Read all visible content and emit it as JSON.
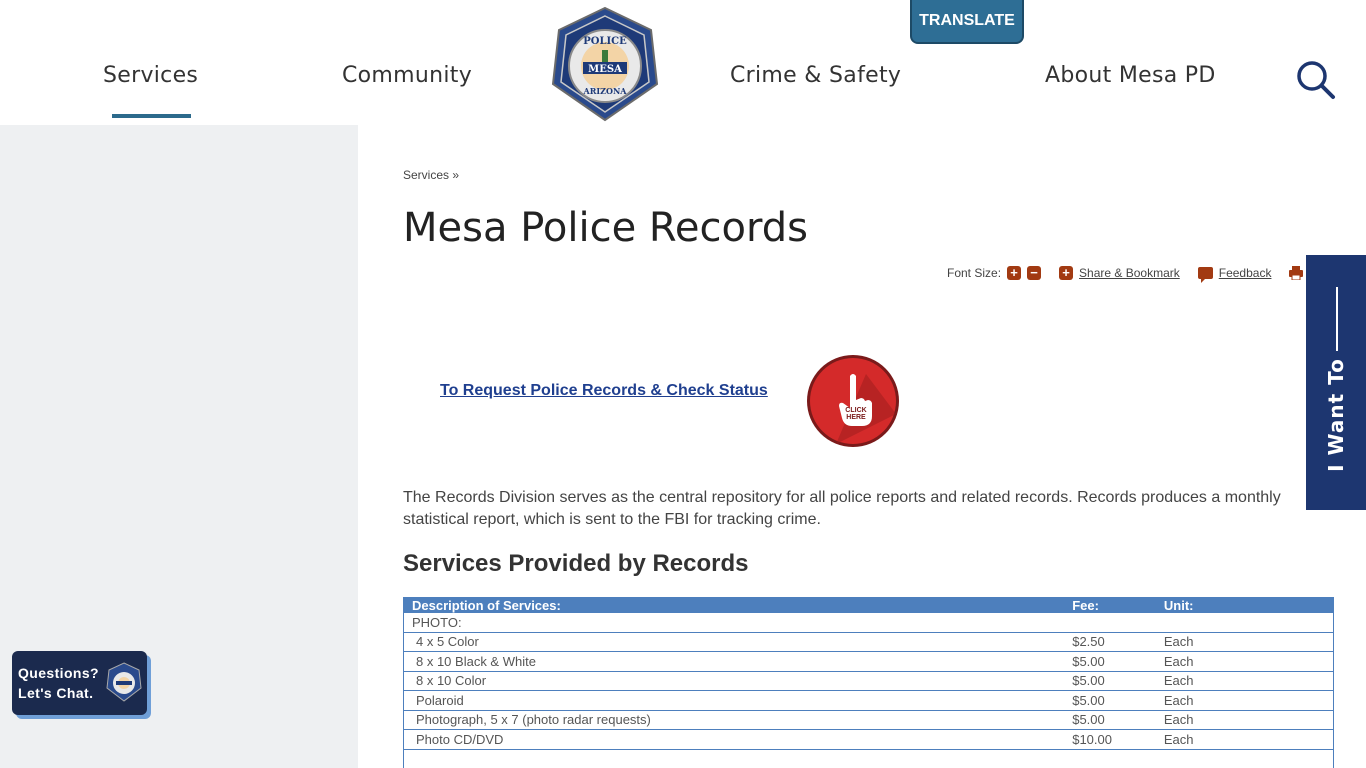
{
  "nav": {
    "items": [
      {
        "label": "Services"
      },
      {
        "label": "Community"
      },
      {
        "label": "Crime & Safety"
      },
      {
        "label": "About Mesa PD"
      }
    ],
    "translate_label": "TRANSLATE"
  },
  "logo": {
    "top_text": "POLICE",
    "middle_text": "MESA",
    "bottom_text": "ARIZONA"
  },
  "breadcrumb": {
    "label": "Services",
    "separator": "»"
  },
  "page": {
    "title": "Mesa Police Records"
  },
  "tools": {
    "font_size_label": "Font Size:",
    "share_label": "Share & Bookmark",
    "feedback_label": "Feedback"
  },
  "request": {
    "link_label": "To Request Police Records & Check Status",
    "button_text_1": "CLICK",
    "button_text_2": "HERE"
  },
  "intro_text": "The Records Division serves as the central repository for all police reports and related records. Records produces a monthly statistical report, which is sent to the FBI for tracking crime.",
  "section_title": "Services Provided by Records",
  "fees": {
    "headers": [
      "Description of Services:",
      "Fee:",
      "Unit:"
    ],
    "category": "PHOTO:",
    "rows": [
      {
        "description": "4 x 5 Color",
        "fee": "$2.50",
        "unit": "Each"
      },
      {
        "description": "8 x 10 Black & White",
        "fee": "$5.00",
        "unit": "Each"
      },
      {
        "description": "8 x 10 Color",
        "fee": "$5.00",
        "unit": "Each"
      },
      {
        "description": "Polaroid",
        "fee": "$5.00",
        "unit": "Each"
      },
      {
        "description": "Photograph, 5 x 7 (photo radar requests)",
        "fee": "$5.00",
        "unit": "Each"
      },
      {
        "description": "Photo CD/DVD",
        "fee": "$10.00",
        "unit": "Each"
      }
    ]
  },
  "i_want_to_label": "I Want To",
  "chat": {
    "line1": "Questions?",
    "line2": "Let's Chat."
  },
  "colors": {
    "accent": "#2c6a8c",
    "table_header": "#4d7fbd",
    "tool_icon": "#a23a12",
    "i_want_bg": "#1d3670"
  }
}
